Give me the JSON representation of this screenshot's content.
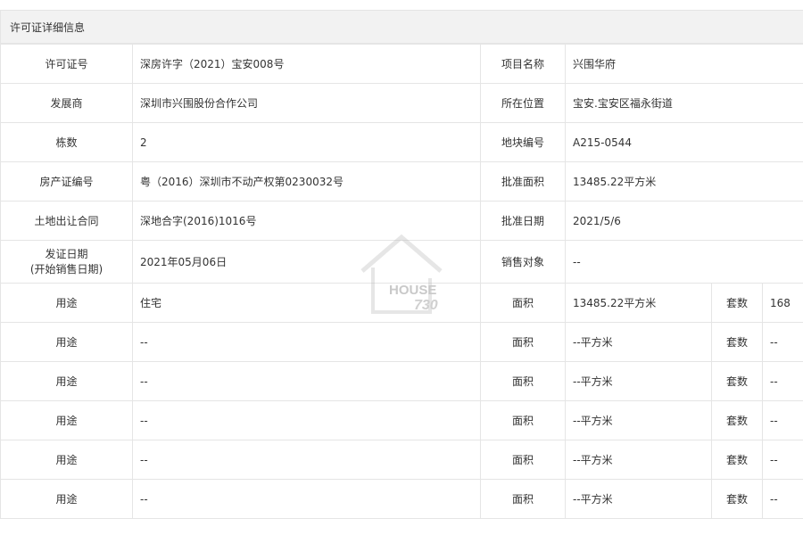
{
  "header": {
    "title": "许可证详细信息"
  },
  "info": [
    {
      "l1": "许可证号",
      "v1": "深房许字（2021）宝安008号",
      "l2": "项目名称",
      "v2": "兴围华府"
    },
    {
      "l1": "发展商",
      "v1": "深圳市兴围股份合作公司",
      "l2": "所在位置",
      "v2": "宝安.宝安区福永街道"
    },
    {
      "l1": "栋数",
      "v1": "2",
      "l2": "地块编号",
      "v2": "A215-0544"
    },
    {
      "l1": "房产证编号",
      "v1": "粤（2016）深圳市不动产权第0230032号",
      "l2": "批准面积",
      "v2": "13485.22平方米"
    },
    {
      "l1": "土地出让合同",
      "v1": "深地合字(2016)1016号",
      "l2": "批准日期",
      "v2": "2021/5/6"
    }
  ],
  "issue": {
    "label_line1": "发证日期",
    "label_line2": "(开始销售日期)",
    "value": "2021年05月06日",
    "target_label": "销售对象",
    "target_value": "--"
  },
  "usage_rows": [
    {
      "use_label": "用途",
      "use": "住宅",
      "area_label": "面积",
      "area": "13485.22平方米",
      "sets_label": "套数",
      "sets": "168"
    },
    {
      "use_label": "用途",
      "use": "--",
      "area_label": "面积",
      "area": "--平方米",
      "sets_label": "套数",
      "sets": "--"
    },
    {
      "use_label": "用途",
      "use": "--",
      "area_label": "面积",
      "area": "--平方米",
      "sets_label": "套数",
      "sets": "--"
    },
    {
      "use_label": "用途",
      "use": "--",
      "area_label": "面积",
      "area": "--平方米",
      "sets_label": "套数",
      "sets": "--"
    },
    {
      "use_label": "用途",
      "use": "--",
      "area_label": "面积",
      "area": "--平方米",
      "sets_label": "套数",
      "sets": "--"
    },
    {
      "use_label": "用途",
      "use": "--",
      "area_label": "面积",
      "area": "--平方米",
      "sets_label": "套数",
      "sets": "--"
    }
  ],
  "watermark": {
    "text": "HOUSE",
    "number": "730",
    "icon": "house-logo-icon"
  }
}
